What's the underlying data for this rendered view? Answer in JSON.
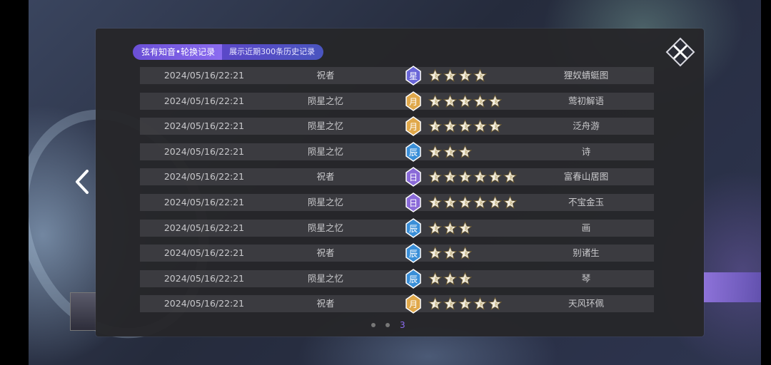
{
  "title": {
    "main": "弦有知音•轮换记录",
    "sub": "展示近期300条历史记录"
  },
  "pager": {
    "current": "3"
  },
  "colors": {
    "accent": "#8b6cf0",
    "badge_xing": "#6a66d8",
    "badge_yue": "#e0a84a",
    "badge_chen": "#3a8fd8",
    "badge_ri": "#8a6ad8"
  },
  "records": [
    {
      "time": "2024/05/16/22:21",
      "type": "祝者",
      "badge": "星",
      "stars": 4,
      "name": "狸奴蜻蜓图"
    },
    {
      "time": "2024/05/16/22:21",
      "type": "陨星之忆",
      "badge": "月",
      "stars": 5,
      "name": "莺初解语"
    },
    {
      "time": "2024/05/16/22:21",
      "type": "陨星之忆",
      "badge": "月",
      "stars": 5,
      "name": "泛舟游"
    },
    {
      "time": "2024/05/16/22:21",
      "type": "陨星之忆",
      "badge": "辰",
      "stars": 3,
      "name": "诗"
    },
    {
      "time": "2024/05/16/22:21",
      "type": "祝者",
      "badge": "日",
      "stars": 6,
      "name": "富春山居图"
    },
    {
      "time": "2024/05/16/22:21",
      "type": "陨星之忆",
      "badge": "日",
      "stars": 6,
      "name": "不宝金玉"
    },
    {
      "time": "2024/05/16/22:21",
      "type": "陨星之忆",
      "badge": "辰",
      "stars": 3,
      "name": "画"
    },
    {
      "time": "2024/05/16/22:21",
      "type": "祝者",
      "badge": "辰",
      "stars": 3,
      "name": "别诸生"
    },
    {
      "time": "2024/05/16/22:21",
      "type": "陨星之忆",
      "badge": "辰",
      "stars": 3,
      "name": "琴"
    },
    {
      "time": "2024/05/16/22:21",
      "type": "祝者",
      "badge": "月",
      "stars": 5,
      "name": "天风环佩"
    }
  ]
}
